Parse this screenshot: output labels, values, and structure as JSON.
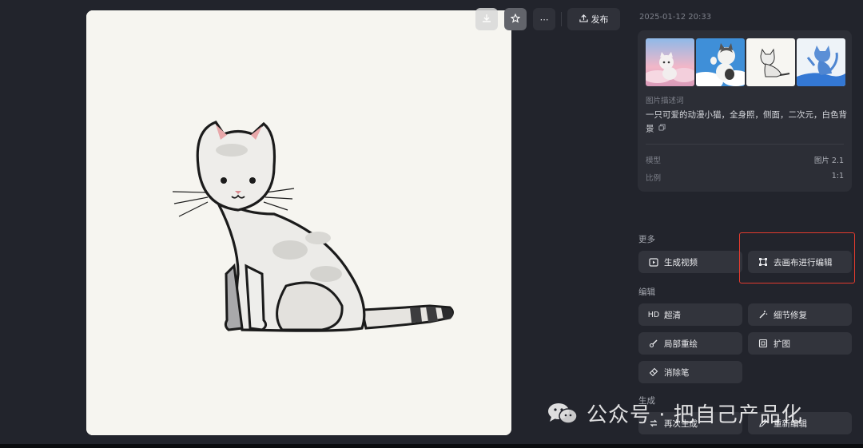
{
  "toolbar": {
    "download_icon": "download-icon",
    "favorite_icon": "star-icon",
    "more_icon": "more-icon",
    "more_label": "⋯",
    "publish_label": "发布",
    "publish_icon": "upload-icon"
  },
  "details": {
    "timestamp": "2025-01-12 20:33",
    "description_label": "图片描述词",
    "description": "一只可爱的动漫小猫，全身照，侧面，二次元，白色背景",
    "copy_icon": "copy-icon",
    "model_label": "模型",
    "model_value": "图片 2.1",
    "ratio_label": "比例",
    "ratio_value": "1:1"
  },
  "more_section": {
    "title": "更多",
    "generate_video": "生成视频",
    "edit_on_canvas": "去画布进行编辑"
  },
  "edit_section": {
    "title": "编辑",
    "hd_prefix": "HD",
    "upscale": "超清",
    "detail_repair": "细节修复",
    "inpaint": "局部重绘",
    "outpaint": "扩图",
    "eraser": "消除笔"
  },
  "generate_section": {
    "title": "生成",
    "regenerate": "再次生成",
    "re_edit": "重新编辑"
  },
  "watermark": {
    "text": "公众号 · 把自己产品化",
    "logo": "wechat-logo"
  },
  "colors": {
    "background": "#22242c",
    "card": "#2c2e36",
    "button": "#32343c",
    "highlight": "#e23b2e"
  }
}
